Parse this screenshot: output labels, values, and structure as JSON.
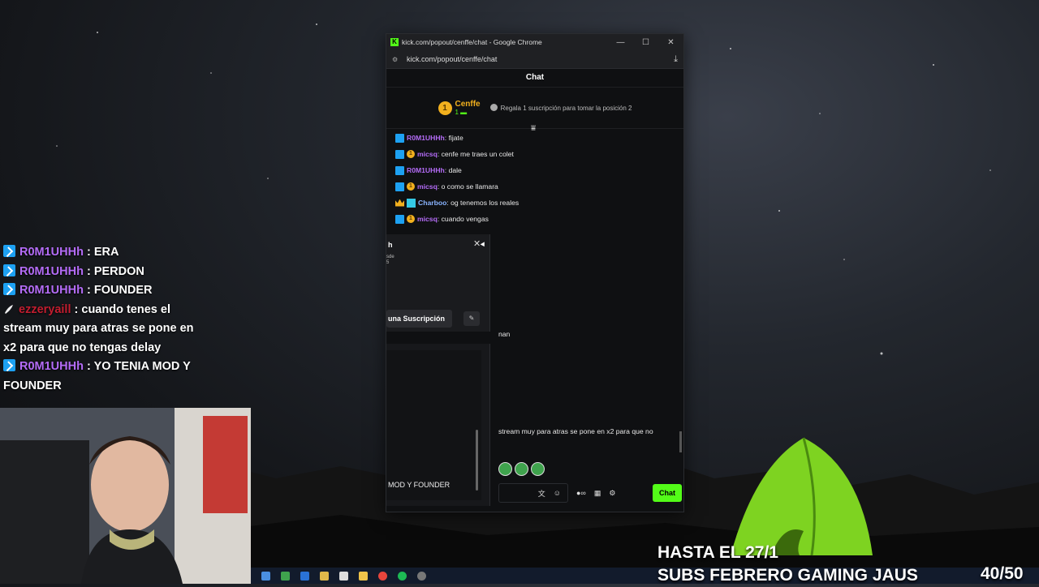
{
  "overlay_chat": [
    {
      "user": "R0M1UHHh",
      "text": " : ERA"
    },
    {
      "user": "R0M1UHHh",
      "text": " : PERDON"
    },
    {
      "user": "R0M1UHHh",
      "text": " : FOUNDER"
    },
    {
      "user": "ezzeryaill",
      "text": " : cuando tenes el stream muy para atras se pone en x2 para que no tengas delay"
    },
    {
      "user": "R0M1UHHh",
      "text": " : YO TENIA MOD Y FOUNDER"
    }
  ],
  "window": {
    "title": "kick.com/popout/cenffe/chat - Google Chrome",
    "url": "kick.com/popout/cenffe/chat",
    "header": "Chat",
    "top_gifter": {
      "rank": "1",
      "name": "Cenffe",
      "count": "1"
    },
    "gift_note": "Regala 1 suscripción para tomar la posición 2"
  },
  "messages": [
    {
      "user": "R0M1UHHh",
      "text": ": fijate"
    },
    {
      "user": "micsq",
      "text": ": cenfe me traes un colet"
    },
    {
      "user": "R0M1UHHh",
      "text": ": dale"
    },
    {
      "user": "micsq",
      "text": ": o como se llamara"
    },
    {
      "user": "Charboo",
      "text": ": og tenemos los reales"
    },
    {
      "user": "micsq",
      "text": ": cuando vengas"
    }
  ],
  "popup": {
    "title_fragment": "h",
    "frag1": "sde",
    "frag2": "5",
    "sub_button": "una Suscripción",
    "card2_text": "MOD Y FOUNDER"
  },
  "fragments": {
    "an": "nan",
    "stream": "stream muy para atras se pone en x2 para que no"
  },
  "bottom": {
    "chat_button": "Chat"
  },
  "sub_goal": {
    "line1": "HASTA EL 27/1",
    "line2": "SUBS FEBRERO GAMING JAUS",
    "count": "40/50"
  }
}
